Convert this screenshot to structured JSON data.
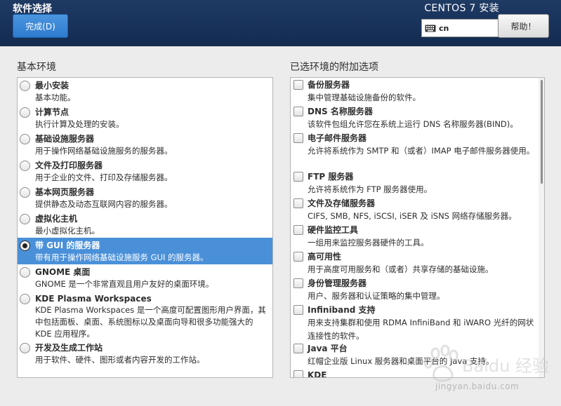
{
  "header": {
    "page_title": "软件选择",
    "done_button": "完成(D)",
    "product_title": "CENTOS 7 安装",
    "keyboard_layout": "cn",
    "help_button": "帮助！"
  },
  "base_env": {
    "title": "基本环境",
    "items": [
      {
        "name": "最小安装",
        "desc": "基本功能。",
        "selected": false
      },
      {
        "name": "计算节点",
        "desc": "执行计算及处理的安装。",
        "selected": false
      },
      {
        "name": "基础设施服务器",
        "desc": "用于操作网络基础设施服务的服务器。",
        "selected": false
      },
      {
        "name": "文件及打印服务器",
        "desc": "用于企业的文件、打印及存储服务器。",
        "selected": false
      },
      {
        "name": "基本网页服务器",
        "desc": "提供静态及动态互联网内容的服务器。",
        "selected": false
      },
      {
        "name": "虚拟化主机",
        "desc": "最小虚拟化主机。",
        "selected": false
      },
      {
        "name": "带 GUI 的服务器",
        "desc": "带有用于操作网络基础设施服务 GUI 的服务器。",
        "selected": true
      },
      {
        "name": "GNOME 桌面",
        "desc": "GNOME 是一个非常直观且用户友好的桌面环境。",
        "selected": false
      },
      {
        "name": "KDE Plasma Workspaces",
        "desc": "KDE Plasma Workspaces 是一个高度可配置图形用户界面，其中包括面板、桌面、系统图标以及桌面向导和很多功能强大的 KDE 应用程序。",
        "selected": false
      },
      {
        "name": "开发及生成工作站",
        "desc": "用于软件、硬件、图形或者内容开发的工作站。",
        "selected": false
      }
    ]
  },
  "addons": {
    "title": "已选环境的附加选项",
    "items": [
      {
        "name": "备份服务器",
        "desc": "集中管理基础设施备份的软件。"
      },
      {
        "name": "DNS 名称服务器",
        "desc": "该软件包组允许您在系统上运行 DNS 名称服务器(BIND)。"
      },
      {
        "name": "电子邮件服务器",
        "desc": "允许将系统作为 SMTP 和（或者）IMAP 电子邮件服务器使用。"
      },
      {
        "name": "FTP 服务器",
        "desc": "允许将系统作为 FTP 服务器使用。"
      },
      {
        "name": "文件及存储服务器",
        "desc": "CIFS, SMB, NFS, iSCSI, iSER 及 iSNS 网络存储服务器。"
      },
      {
        "name": "硬件监控工具",
        "desc": "一组用来监控服务器硬件的工具。"
      },
      {
        "name": "高可用性",
        "desc": "用于高度可用服务和（或者）共享存储的基础设施。"
      },
      {
        "name": "身份管理服务器",
        "desc": "用户、服务器和认证策略的集中管理。"
      },
      {
        "name": "Infiniband 支持",
        "desc": "用来支持集群和使用 RDMA InfiniBand 和 iWARO 光纤的网状连接性的软件。"
      },
      {
        "name": "Java 平台",
        "desc": "红帽企业版 Linux 服务器和桌面平台的 Java 支持。"
      },
      {
        "name": "KDE",
        "desc": ""
      }
    ]
  },
  "watermark": {
    "text": "jingyan.baidu.com",
    "logo": "Baidu 经验"
  },
  "colors": {
    "header_bg": "#1a355d",
    "accent": "#4a90d9",
    "done_button": "#3a86d6"
  }
}
